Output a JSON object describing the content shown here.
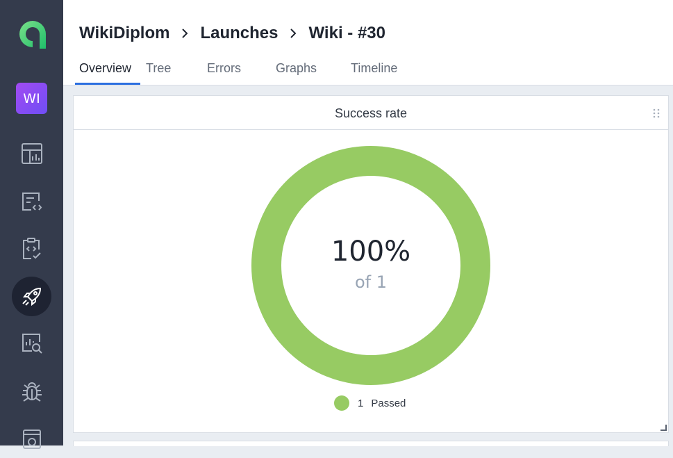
{
  "header": {
    "breadcrumb": [
      "WikiDiplom",
      "Launches",
      "Wiki - #30"
    ],
    "tabs": [
      "Overview",
      "Tree",
      "Errors",
      "Graphs",
      "Timeline"
    ],
    "active_tab": "Overview"
  },
  "sidebar": {
    "project_badge": "WI",
    "icons": [
      "dashboard-icon",
      "test-cases-icon",
      "test-plans-icon",
      "launches-icon",
      "analytics-icon",
      "defects-icon",
      "test-runs-icon"
    ],
    "active_icon": "launches-icon"
  },
  "widget": {
    "title": "Success rate",
    "percent_label": "100%",
    "total_label": "of 1",
    "legend": {
      "count": "1",
      "label": "Passed"
    },
    "passed_fraction": 1.0,
    "color": "#97cb63"
  }
}
